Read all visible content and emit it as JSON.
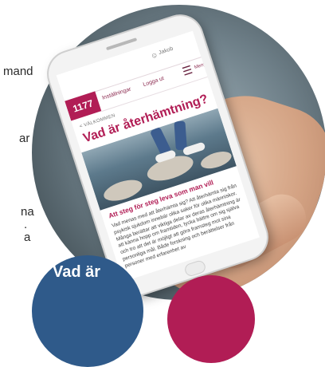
{
  "left_text_fragments": [
    "mand",
    "ar",
    "na",
    ".",
    "a"
  ],
  "phone_screen": {
    "account_label": "Jakob",
    "logo_text": "1177",
    "nav": {
      "settings_label": "Inställningar",
      "logout_label": "Logga ut",
      "menu_label": "Meny"
    },
    "breadcrumb": "< VÄLKOMMEN",
    "headline": "Vad är återhämtning?",
    "subheadline": "Att steg för steg leva som man vill",
    "body": "Vad menas med att återhämta sig? Att återhämta sig från psykisk sjukdom innebär olika saker för olika människor. Många berättar att viktiga delar av deras återhämtning är att känna hopp om framtiden, tycka bättre om sig själva och tro att det är möjligt att göra framsteg mot sina personliga mål. Både forskning och berättelser från personer med erfarenhet av"
  },
  "badge": {
    "text": "Vad är"
  },
  "colors": {
    "brand": "#b11d55",
    "badge_blue": "#2f5a8a"
  }
}
